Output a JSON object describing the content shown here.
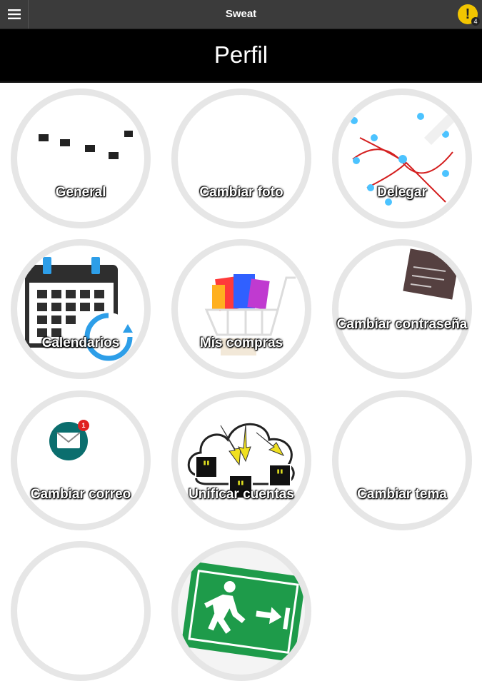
{
  "header": {
    "app_title": "Sweat",
    "notification_count": "4"
  },
  "page": {
    "title": "Perfil"
  },
  "tiles": [
    {
      "label": "General"
    },
    {
      "label": "Cambiar foto"
    },
    {
      "label": "Delegar"
    },
    {
      "label": "Calendarios"
    },
    {
      "label": "Mis compras"
    },
    {
      "label": "Cambiar contraseña"
    },
    {
      "label": "Cambiar correo",
      "badge": "1"
    },
    {
      "label": "Unificar cuentas"
    },
    {
      "label": "Cambiar tema"
    }
  ],
  "colors": {
    "topbar": "#3b3b3b",
    "titlebar": "#000000",
    "alert": "#f2c500",
    "tile_ring": "#e6e6e6"
  }
}
